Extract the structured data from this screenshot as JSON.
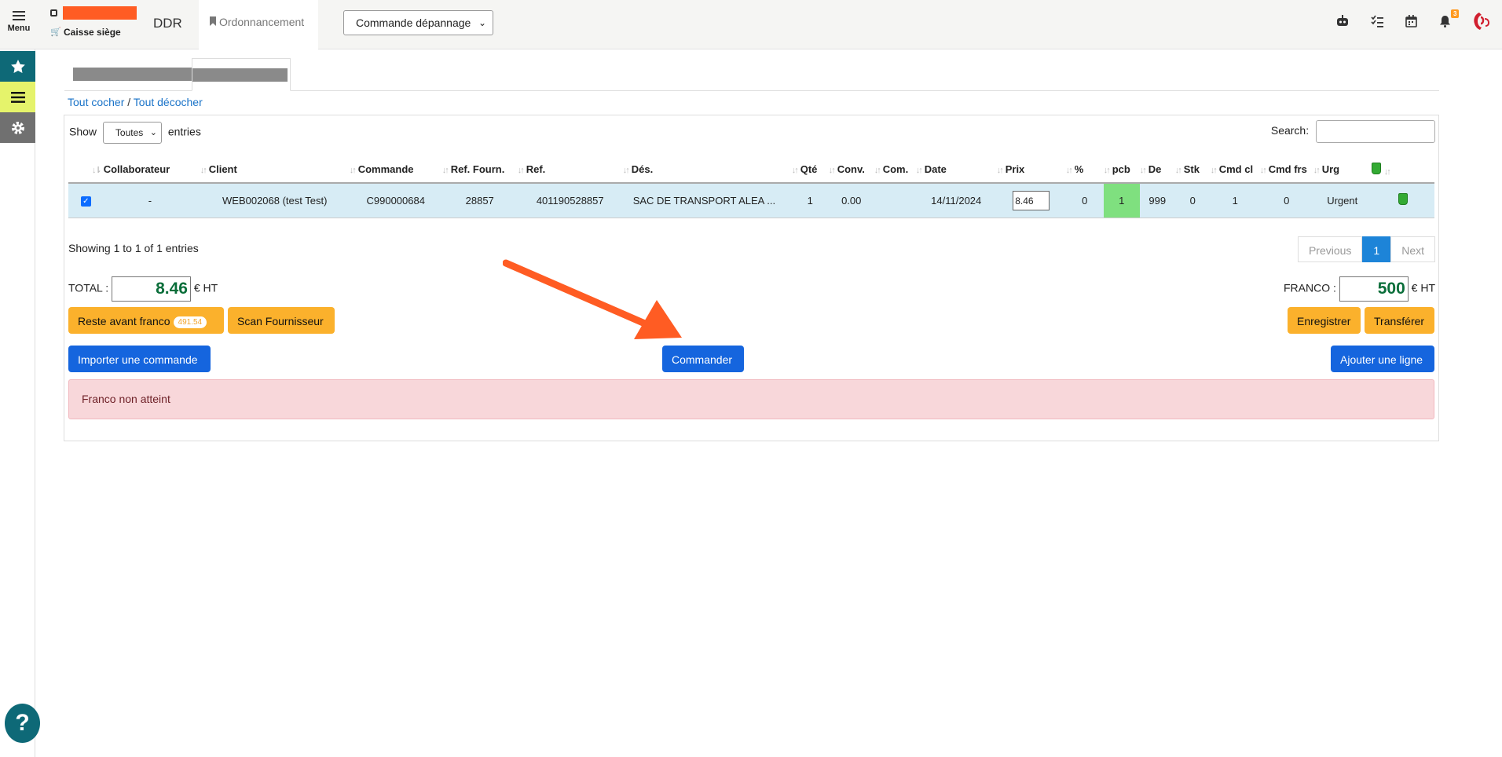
{
  "topbar": {
    "menu_label": "Menu",
    "store_label": "Caisse siège",
    "site_code": "DDR",
    "active_tab": "Ordonnancement",
    "order_type_select": "Commande dépannage",
    "notification_count": "3"
  },
  "content": {
    "check_all": "Tout cocher",
    "separator": "/",
    "uncheck_all": "Tout décocher",
    "show_label": "Show",
    "show_value": "Toutes",
    "entries_label": "entries",
    "search_label": "Search:",
    "columns": [
      "Collaborateur",
      "Client",
      "Commande",
      "Ref. Fourn.",
      "Ref.",
      "Dés.",
      "Qté",
      "Conv.",
      "Com.",
      "Date",
      "Prix",
      "%",
      "pcb",
      "De",
      "Stk",
      "Cmd cl",
      "Cmd frs",
      "Urg"
    ],
    "row": {
      "collaborateur": "-",
      "client": "WEB002068 (test Test)",
      "commande": "C990000684",
      "ref_fourn": "28857",
      "ref": "401190528857",
      "des": "SAC DE TRANSPORT ALEA ...",
      "qte": "1",
      "conv": "0.00",
      "com": "",
      "date": "14/11/2024",
      "prix": "8.46",
      "pct": "0",
      "pcb": "1",
      "de": "999",
      "stk": "0",
      "cmd_cl": "1",
      "cmd_frs": "0",
      "urg": "Urgent"
    },
    "showing_text": "Showing 1 to 1 of 1 entries",
    "pager": {
      "previous": "Previous",
      "current": "1",
      "next": "Next"
    },
    "total_label": "TOTAL :",
    "total_value": "8.46",
    "currency": "€ HT",
    "franco_label": "FRANCO :",
    "franco_value": "500",
    "reste_label": "Reste avant franco",
    "reste_value": "491.54",
    "scan_label": "Scan Fournisseur",
    "save_label": "Enregistrer",
    "transfer_label": "Transférer",
    "import_label": "Importer une commande",
    "order_label": "Commander",
    "add_line_label": "Ajouter une ligne",
    "alert_text": "Franco non atteint"
  },
  "colors": {
    "accent_teal": "#0e6977",
    "primary_blue": "#1565de",
    "orange_button": "#fbb12c",
    "annotation_arrow": "#ff5c23",
    "alert_bg": "#f8d7da"
  }
}
